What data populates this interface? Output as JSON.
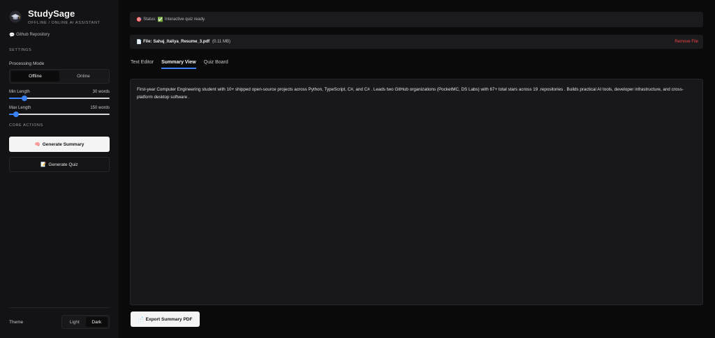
{
  "sidebar": {
    "app_name": "StudySage",
    "tagline": "OFFLINE / ONLINE AI ASSISTANT",
    "github_icon": "💬",
    "github_label": "Github Repository",
    "settings_label": "SETTINGS",
    "processing_mode": {
      "label": "Processing Mode",
      "options": [
        "Offline",
        "Online"
      ],
      "selected": "Offline"
    },
    "min_length": {
      "label": "Min Length",
      "value_text": "30 words",
      "value": 30,
      "min": 0,
      "max": 200
    },
    "max_length": {
      "label": "Max Length",
      "value_text": "150 words",
      "value": 150,
      "min": 100,
      "max": 800
    },
    "core_actions_label": "CORE ACTIONS",
    "generate_summary": {
      "icon": "🧠",
      "label": "Generate Summary"
    },
    "generate_quiz": {
      "icon": "📝",
      "label": "Generate Quiz"
    },
    "theme": {
      "label": "Theme",
      "options": [
        "Light",
        "Dark"
      ],
      "selected": "Dark"
    }
  },
  "status": {
    "icon": "🎯",
    "prefix": "Status:",
    "check_icon": "✅",
    "message": "Interactive quiz ready."
  },
  "file": {
    "icon": "📄",
    "label": "File:",
    "name": "Sahaj_Italiya_Resume_3.pdf",
    "size": "(0.11 MB)",
    "remove_label": "Remove File"
  },
  "tabs": [
    {
      "label": "Text Editor",
      "active": false
    },
    {
      "label": "Summary View",
      "active": true
    },
    {
      "label": "Quiz Board",
      "active": false
    }
  ],
  "summary": {
    "text": "First-year Computer Engineering student with 10+ shipped open-source projects across Python, TypeScript, C#, and C# . Leads two GitHub organizations (PocketMC, DS Labs) with 67+ total stars across 19 .repositories . Builds practical AI tools, developer infrastructure, and cross-platform desktop software ."
  },
  "export": {
    "icon": "📄",
    "label": "Export Summary PDF"
  },
  "colors": {
    "accent": "#3b82f6",
    "danger": "#ef4444",
    "background": "#0a0a0b",
    "sidebar": "#131315"
  }
}
